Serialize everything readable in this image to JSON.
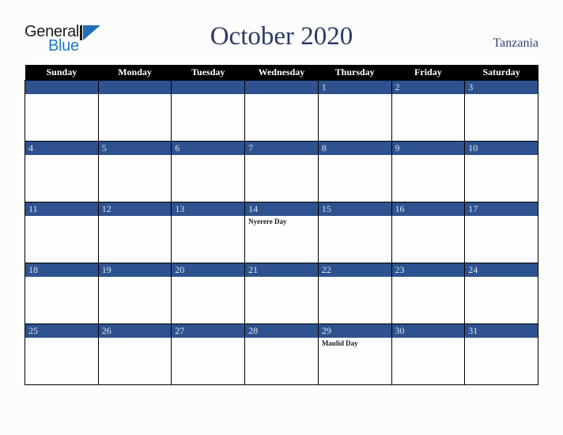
{
  "brand": {
    "name_top": "General",
    "name_bottom": "Blue",
    "mark": "triangle-logo-mark",
    "top_color": "#1c1c1c",
    "bottom_color": "#1f7ac4"
  },
  "header": {
    "title": "October 2020",
    "country": "Tanzania",
    "title_color": "#2a3b63",
    "country_color": "#2f4470"
  },
  "calendar": {
    "accent_color": "#2d528f",
    "header_bg": "#000000",
    "header_text_color": "#ffffff",
    "weekday_headers": [
      "Sunday",
      "Monday",
      "Tuesday",
      "Wednesday",
      "Thursday",
      "Friday",
      "Saturday"
    ],
    "weeks": [
      [
        {
          "day": "",
          "events": []
        },
        {
          "day": "",
          "events": []
        },
        {
          "day": "",
          "events": []
        },
        {
          "day": "",
          "events": []
        },
        {
          "day": "1",
          "events": []
        },
        {
          "day": "2",
          "events": []
        },
        {
          "day": "3",
          "events": []
        }
      ],
      [
        {
          "day": "4",
          "events": []
        },
        {
          "day": "5",
          "events": []
        },
        {
          "day": "6",
          "events": []
        },
        {
          "day": "7",
          "events": []
        },
        {
          "day": "8",
          "events": []
        },
        {
          "day": "9",
          "events": []
        },
        {
          "day": "10",
          "events": []
        }
      ],
      [
        {
          "day": "11",
          "events": []
        },
        {
          "day": "12",
          "events": []
        },
        {
          "day": "13",
          "events": []
        },
        {
          "day": "14",
          "events": [
            "Nyerere Day"
          ]
        },
        {
          "day": "15",
          "events": []
        },
        {
          "day": "16",
          "events": []
        },
        {
          "day": "17",
          "events": []
        }
      ],
      [
        {
          "day": "18",
          "events": []
        },
        {
          "day": "19",
          "events": []
        },
        {
          "day": "20",
          "events": []
        },
        {
          "day": "21",
          "events": []
        },
        {
          "day": "22",
          "events": []
        },
        {
          "day": "23",
          "events": []
        },
        {
          "day": "24",
          "events": []
        }
      ],
      [
        {
          "day": "25",
          "events": []
        },
        {
          "day": "26",
          "events": []
        },
        {
          "day": "27",
          "events": []
        },
        {
          "day": "28",
          "events": []
        },
        {
          "day": "29",
          "events": [
            "Maulid Day"
          ]
        },
        {
          "day": "30",
          "events": []
        },
        {
          "day": "31",
          "events": []
        }
      ]
    ]
  }
}
